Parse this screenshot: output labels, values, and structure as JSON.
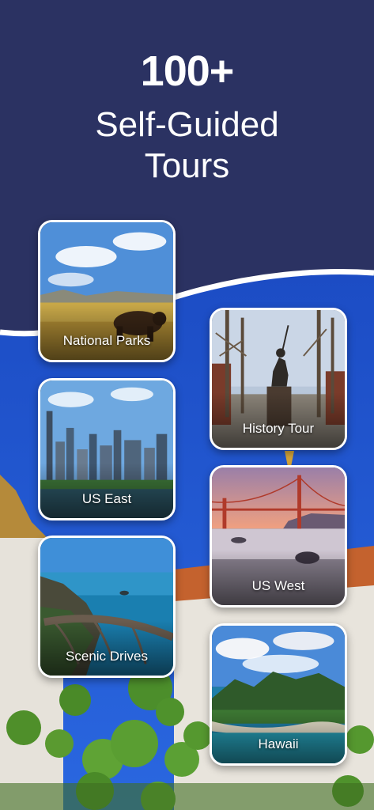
{
  "headline": {
    "count": "100+",
    "line1": "Self-Guided",
    "line2": "Tours"
  },
  "tours": [
    {
      "label": "National Parks"
    },
    {
      "label": "History Tour"
    },
    {
      "label": "US East"
    },
    {
      "label": "US West"
    },
    {
      "label": "Scenic Drives"
    },
    {
      "label": "Hawaii"
    }
  ],
  "colors": {
    "navy": "#2b3262",
    "blue": "#1f4fc4",
    "white": "#ffffff"
  }
}
